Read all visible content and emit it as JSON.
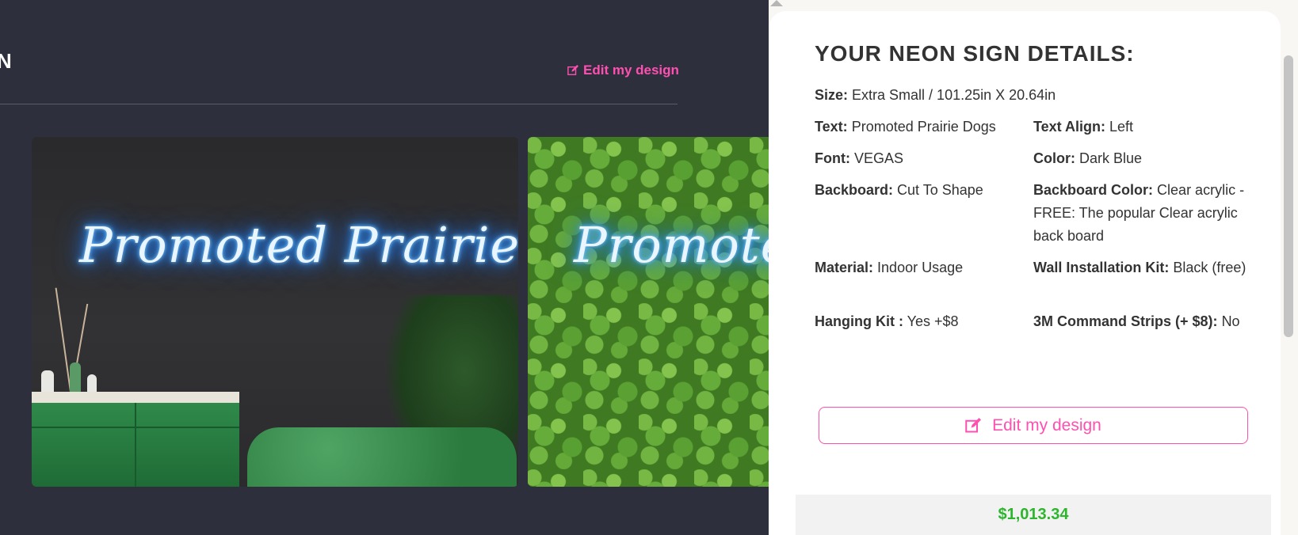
{
  "page": {
    "heading_fragment": "N",
    "edit_link_label": "Edit my design"
  },
  "preview": {
    "neon_text": "Promoted Prairie Dogs",
    "neon_color": "#3aa0ff"
  },
  "panel": {
    "title": "YOUR NEON SIGN DETAILS:",
    "size_label": "Size:",
    "size_value": "Extra Small / 101.25in X 20.64in",
    "text_label": "Text:",
    "text_value": "Promoted Prairie Dogs",
    "text_align_label": "Text Align:",
    "text_align_value": "Left",
    "font_label": "Font:",
    "font_value": "VEGAS",
    "color_label": "Color:",
    "color_value": "Dark Blue",
    "backboard_label": "Backboard:",
    "backboard_value": "Cut To Shape",
    "backboard_color_label": "Backboard Color:",
    "backboard_color_value": "Clear acrylic - FREE: The popular Clear acrylic back board",
    "material_label": "Material:",
    "material_value": "Indoor Usage",
    "wall_kit_label": "Wall Installation Kit:",
    "wall_kit_value": "Black (free)",
    "hanging_kit_label": "Hanging Kit :",
    "hanging_kit_value": "Yes +$8",
    "command_strips_label": "3M Command Strips (+ $8):",
    "command_strips_value": "No",
    "edit_button_label": "Edit my design",
    "price": "$1,013.34"
  },
  "colors": {
    "accent_pink": "#ff4fb0",
    "price_green": "#2db52d",
    "page_bg": "#2d2f3d"
  }
}
